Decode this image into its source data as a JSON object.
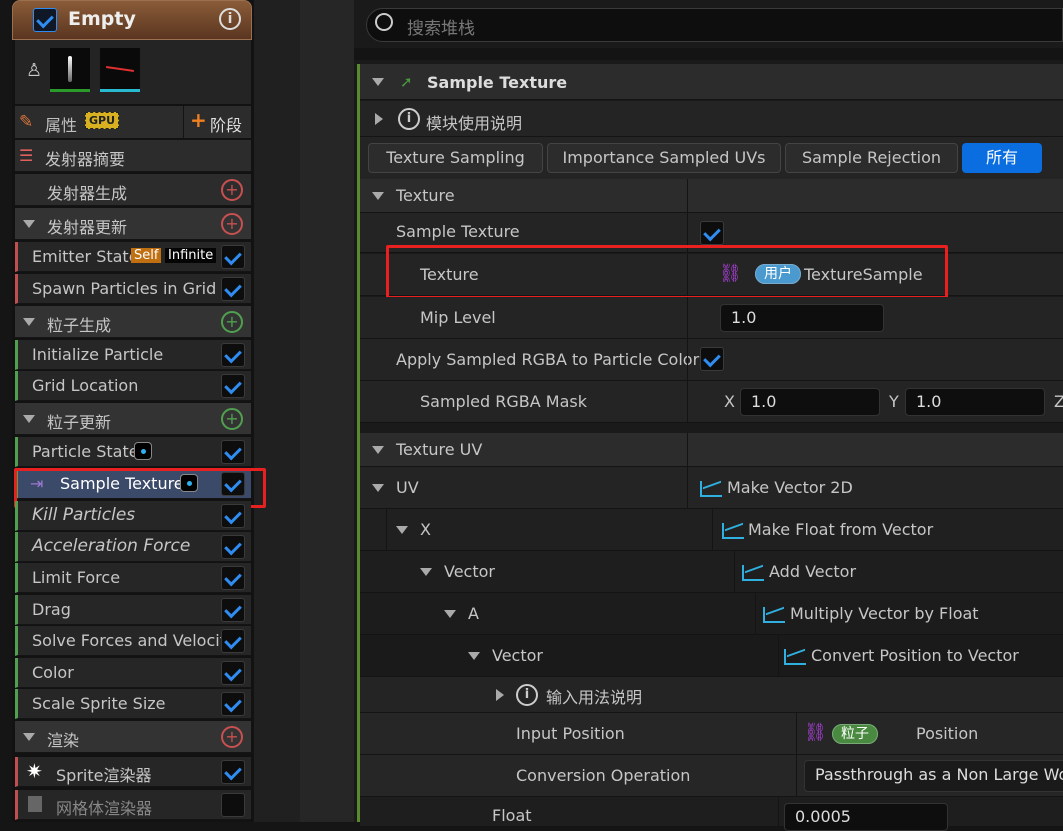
{
  "emitter": {
    "title": "Empty",
    "properties_label": "属性",
    "gpu_badge": "GPU",
    "stage_label": "阶段"
  },
  "left_items": {
    "summary": "发射器摘要",
    "spawn": "发射器生成",
    "update": "发射器更新",
    "emitter_state": "Emitter State",
    "self_badge": "Self",
    "infinite_badge": "Infinite",
    "spawn_grid": "Spawn Particles in Grid",
    "particle_spawn": "粒子生成",
    "init_particle": "Initialize Particle",
    "grid_location": "Grid Location",
    "particle_update": "粒子更新",
    "particle_state": "Particle State",
    "sample_texture": "Sample Texture",
    "kill": "Kill Particles",
    "accel": "Acceleration Force",
    "limit": "Limit Force",
    "drag": "Drag",
    "solve": "Solve Forces and Velocity",
    "color": "Color",
    "scale": "Scale Sprite Size",
    "render": "渲染",
    "sprite": "Sprite渲染器",
    "mesh": "网格体渲染器"
  },
  "search": {
    "placeholder": "搜索堆栈"
  },
  "module": {
    "title": "Sample Texture",
    "usage": "模块使用说明"
  },
  "tabs": [
    "Texture Sampling",
    "Importance Sampled UVs",
    "Sample Rejection",
    "所有"
  ],
  "texture": {
    "section": "Texture",
    "sample_texture": "Sample Texture",
    "texture": "Texture",
    "user_pill": "用户",
    "texture_value": "TextureSample",
    "mip": "Mip Level",
    "mip_value": "1.0",
    "apply": "Apply Sampled RGBA to Particle Color",
    "mask": "Sampled RGBA Mask",
    "x": "X",
    "x_val": "1.0",
    "y": "Y",
    "y_val": "1.0",
    "z": "Z"
  },
  "uv": {
    "section": "Texture UV",
    "uv": "UV",
    "uv_val": "Make Vector 2D",
    "x": "X",
    "x_val": "Make Float from Vector",
    "vector": "Vector",
    "vector_val": "Add Vector",
    "a": "A",
    "a_val": "Multiply Vector by Float",
    "vector2": "Vector",
    "vector2_val": "Convert Position to Vector",
    "input_usage": "输入用法说明",
    "input_pos": "Input Position",
    "particle_pill": "粒子",
    "input_pos_val": "Position",
    "conv": "Conversion Operation",
    "conv_val": "Passthrough as a Non Large World",
    "float": "Float",
    "float_val": "0.0005"
  },
  "colors": {
    "accent": "#0a6ee0",
    "highlight": "#e82020",
    "selected": "#3c4a6a"
  }
}
